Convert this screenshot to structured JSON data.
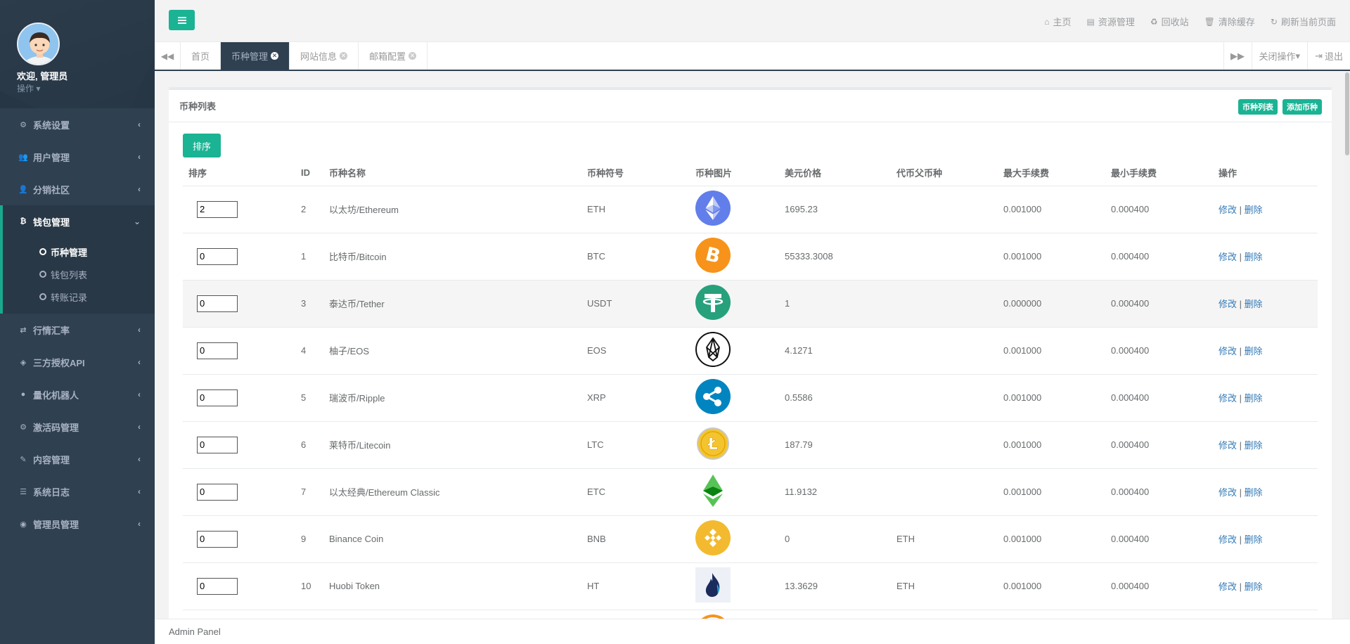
{
  "sidebar": {
    "welcome": "欢迎, 管理员",
    "ops": "操作",
    "menu": [
      {
        "label": "系统设置",
        "icon": "gears-icon"
      },
      {
        "label": "用户管理",
        "icon": "users-icon"
      },
      {
        "label": "分销社区",
        "icon": "user-icon"
      },
      {
        "label": "钱包管理",
        "icon": "bitcoin-icon"
      },
      {
        "label": "行情汇率",
        "icon": "exchange-icon"
      },
      {
        "label": "三方授权API",
        "icon": "cube-icon"
      },
      {
        "label": "量化机器人",
        "icon": "android-icon"
      },
      {
        "label": "激活码管理",
        "icon": "gear-icon"
      },
      {
        "label": "内容管理",
        "icon": "edit-icon"
      },
      {
        "label": "系统日志",
        "icon": "database-icon"
      },
      {
        "label": "管理员管理",
        "icon": "user-circle-icon"
      }
    ],
    "submenu": [
      "币种管理",
      "钱包列表",
      "转账记录"
    ]
  },
  "topbar": {
    "links": [
      {
        "label": "主页",
        "icon": "home-icon"
      },
      {
        "label": "资源管理",
        "icon": "file-icon"
      },
      {
        "label": "回收站",
        "icon": "recycle-icon"
      },
      {
        "label": "清除缓存",
        "icon": "trash-icon"
      },
      {
        "label": "刷新当前页面",
        "icon": "refresh-icon"
      }
    ]
  },
  "tabs": [
    "首页",
    "币种管理",
    "网站信息",
    "邮箱配置"
  ],
  "tabbar_right": {
    "close_ops": "关闭操作",
    "logout": "退出"
  },
  "panel": {
    "title": "币种列表",
    "btn_list": "币种列表",
    "btn_add": "添加币种",
    "btn_sort": "排序"
  },
  "table": {
    "headers": [
      "排序",
      "ID",
      "币种名称",
      "币种符号",
      "币种图片",
      "美元价格",
      "代币父币种",
      "最大手续费",
      "最小手续费",
      "操作"
    ],
    "rows": [
      {
        "sort": "2",
        "id": "2",
        "name": "以太坊/Ethereum",
        "symbol": "ETH",
        "icon": "eth",
        "price": "1695.23",
        "parent": "",
        "max_fee": "0.001000",
        "min_fee": "0.000400"
      },
      {
        "sort": "0",
        "id": "1",
        "name": "比特币/Bitcoin",
        "symbol": "BTC",
        "icon": "btc",
        "price": "55333.3008",
        "parent": "",
        "max_fee": "0.001000",
        "min_fee": "0.000400"
      },
      {
        "sort": "0",
        "id": "3",
        "name": "泰达币/Tether",
        "symbol": "USDT",
        "icon": "usdt",
        "price": "1",
        "parent": "",
        "max_fee": "0.000000",
        "min_fee": "0.000400"
      },
      {
        "sort": "0",
        "id": "4",
        "name": "柚子/EOS",
        "symbol": "EOS",
        "icon": "eos",
        "price": "4.1271",
        "parent": "",
        "max_fee": "0.001000",
        "min_fee": "0.000400"
      },
      {
        "sort": "0",
        "id": "5",
        "name": "瑞波币/Ripple",
        "symbol": "XRP",
        "icon": "xrp",
        "price": "0.5586",
        "parent": "",
        "max_fee": "0.001000",
        "min_fee": "0.000400"
      },
      {
        "sort": "0",
        "id": "6",
        "name": "莱特币/Litecoin",
        "symbol": "LTC",
        "icon": "ltc",
        "price": "187.79",
        "parent": "",
        "max_fee": "0.001000",
        "min_fee": "0.000400"
      },
      {
        "sort": "0",
        "id": "7",
        "name": "以太经典/Ethereum Classic",
        "symbol": "ETC",
        "icon": "etc",
        "price": "11.9132",
        "parent": "",
        "max_fee": "0.001000",
        "min_fee": "0.000400"
      },
      {
        "sort": "0",
        "id": "9",
        "name": "Binance Coin",
        "symbol": "BNB",
        "icon": "bnb",
        "price": "0",
        "parent": "ETH",
        "max_fee": "0.001000",
        "min_fee": "0.000400"
      },
      {
        "sort": "0",
        "id": "10",
        "name": "Huobi Token",
        "symbol": "HT",
        "icon": "ht",
        "price": "13.3629",
        "parent": "ETH",
        "max_fee": "0.001000",
        "min_fee": "0.000400"
      }
    ],
    "edit_label": "修改",
    "sep": "|",
    "delete_label": "删除"
  },
  "footer": "Admin Panel"
}
